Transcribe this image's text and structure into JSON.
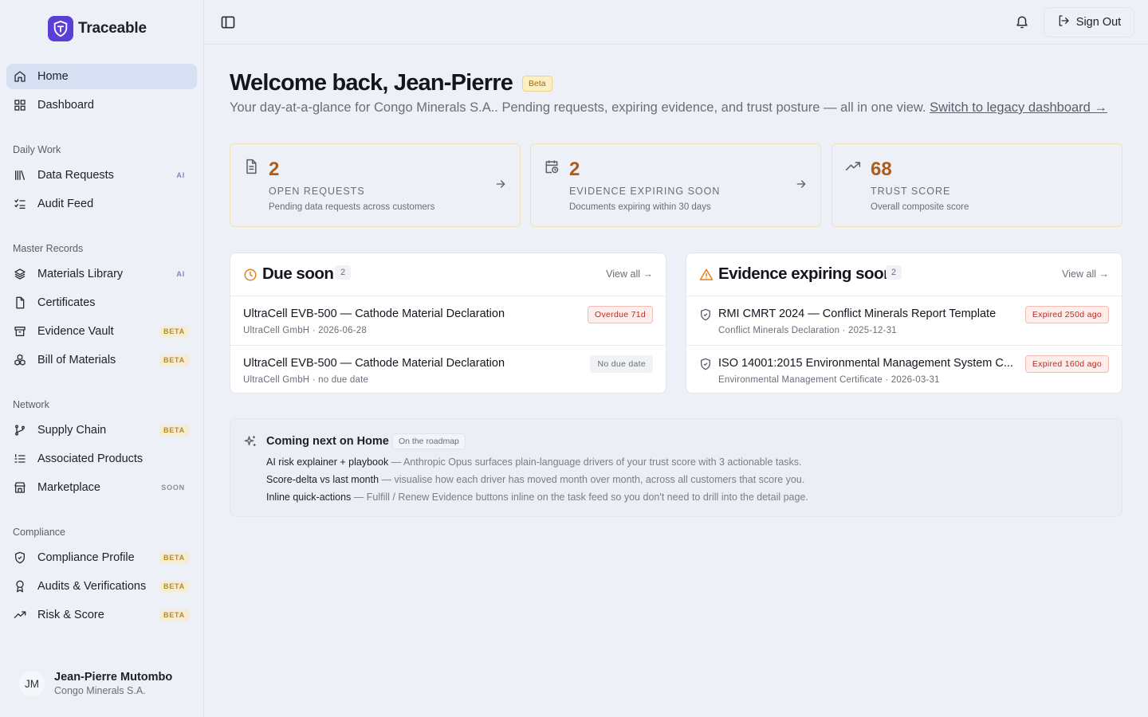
{
  "brand": {
    "name": "Traceable"
  },
  "sidebar": {
    "top_items": [
      {
        "label": "Home",
        "icon": "home-icon",
        "active": true
      },
      {
        "label": "Dashboard",
        "icon": "grid-icon"
      }
    ],
    "sections": [
      {
        "title": "Daily Work",
        "items": [
          {
            "label": "Data Requests",
            "badge": "AI"
          },
          {
            "label": "Audit Feed",
            "badge": ""
          }
        ]
      },
      {
        "title": "Master Records",
        "items": [
          {
            "label": "Materials Library",
            "badge": "AI"
          },
          {
            "label": "Certificates",
            "badge": ""
          },
          {
            "label": "Evidence Vault",
            "badge": "BETA"
          },
          {
            "label": "Bill of Materials",
            "badge": "BETA"
          }
        ]
      },
      {
        "title": "Network",
        "items": [
          {
            "label": "Supply Chain",
            "badge": "BETA"
          },
          {
            "label": "Associated Products",
            "badge": ""
          },
          {
            "label": "Marketplace",
            "badge": "SOON"
          }
        ]
      },
      {
        "title": "Compliance",
        "items": [
          {
            "label": "Compliance Profile",
            "badge": "BETA"
          },
          {
            "label": "Audits & Verifications",
            "badge": "BETA"
          },
          {
            "label": "Risk & Score",
            "badge": "BETA"
          }
        ]
      }
    ]
  },
  "user": {
    "initials": "JM",
    "name": "Jean-Pierre Mutombo",
    "org": "Congo Minerals S.A."
  },
  "topbar": {
    "sign_out": "Sign Out"
  },
  "main": {
    "title": "Welcome back, Jean-Pierre",
    "beta": "Beta",
    "subtitle": "Your day-at-a-glance for Congo Minerals S.A.. Pending requests, expiring evidence, and trust posture — all in one view.",
    "legacy_link": "Switch to legacy dashboard →"
  },
  "stats": [
    {
      "value": "2",
      "label": "OPEN REQUESTS",
      "desc": "Pending data requests across customers",
      "icon": "document-icon"
    },
    {
      "value": "2",
      "label": "EVIDENCE EXPIRING SOON",
      "desc": "Documents expiring within 30 days",
      "icon": "calendar-clock-icon"
    },
    {
      "value": "68",
      "label": "TRUST SCORE",
      "desc": "Overall composite score",
      "icon": "trending-up-icon"
    }
  ],
  "due_soon": {
    "title": "Due soon",
    "count": "2",
    "view_all": "View all →",
    "rows": [
      {
        "title": "UltraCell EVB-500 — Cathode Material Declaration",
        "sub": "UltraCell GmbH · 2026-06-28",
        "tag": "Overdue 71d"
      },
      {
        "title": "UltraCell EVB-500 — Cathode Material Declaration",
        "sub": "UltraCell GmbH · no due date",
        "tag": "No due date"
      }
    ]
  },
  "evidence": {
    "title": "Evidence expiring soon",
    "count": "2",
    "view_all": "View all →",
    "rows": [
      {
        "title": "RMI CMRT 2024 — Conflict Minerals Report Template",
        "sub": "Conflict Minerals Declaration · 2025-12-31",
        "tag": "Expired 250d ago"
      },
      {
        "title": "ISO 14001:2015 Environmental Management System C...",
        "sub": "Environmental Management Certificate · 2026-03-31",
        "tag": "Expired 160d ago"
      }
    ]
  },
  "roadmap": {
    "title": "Coming next on Home",
    "pill": "On the roadmap",
    "items": [
      {
        "name": "AI risk explainer + playbook",
        "text": " — Anthropic Opus surfaces plain-language drivers of your trust score with 3 actionable tasks."
      },
      {
        "name": "Score-delta vs last month",
        "text": " — visualise how each driver has moved month over month, across all customers that score you."
      },
      {
        "name": "Inline quick-actions",
        "text": " — Fulfill / Renew Evidence buttons inline on the task feed so you don't need to drill into the detail page."
      }
    ]
  },
  "colors": {
    "accent": "#5b3fd6",
    "stat_value": "#b05a18",
    "danger": "#c0281e"
  }
}
